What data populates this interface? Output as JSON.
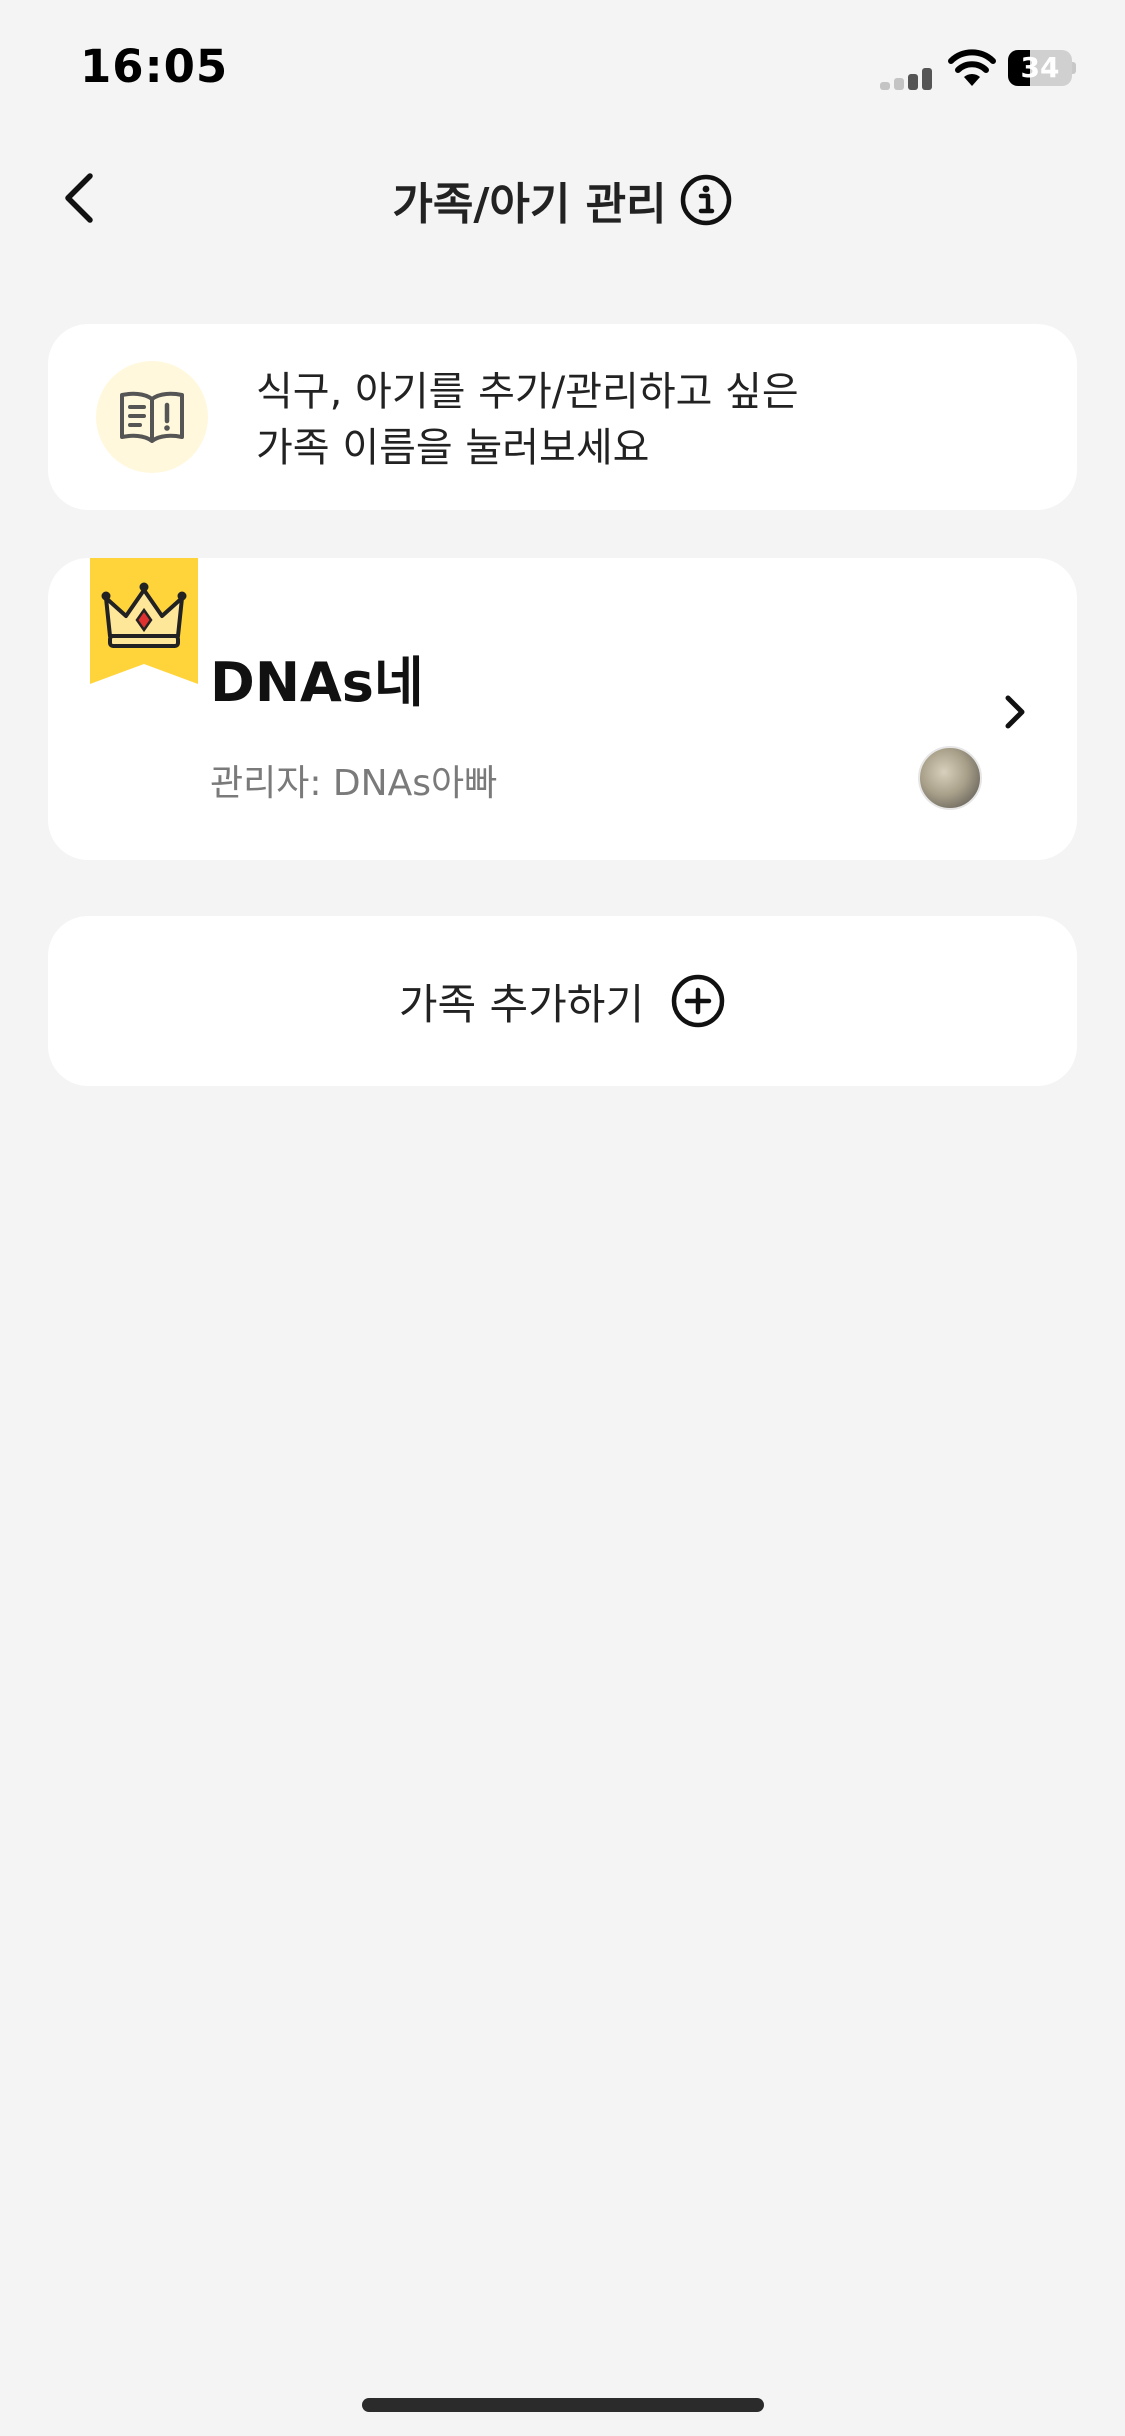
{
  "status_bar": {
    "time": "16:05",
    "battery_level": "34",
    "battery_fraction": 0.34
  },
  "header": {
    "title": "가족/아기 관리",
    "back_icon": "chevron-left-icon",
    "info_icon": "info-icon"
  },
  "hint": {
    "icon": "open-book-exclamation-icon",
    "line1": "식구, 아기를 추가/관리하고 싶은",
    "line2": "가족 이름을 눌러보세요"
  },
  "family": {
    "name": "DNAs네",
    "admin_label": "관리자: DNAs아빠",
    "badge_icon": "crown-icon",
    "avatar_icon": "admin-avatar",
    "open_icon": "chevron-right-icon"
  },
  "add_family": {
    "label": "가족 추가하기",
    "icon": "plus-circle-icon"
  },
  "colors": {
    "background": "#f4f4f4",
    "card": "#ffffff",
    "accent_yellow": "#ffd43b",
    "hint_icon_bg": "#fff8dc",
    "muted_text": "#7a7a7a"
  }
}
